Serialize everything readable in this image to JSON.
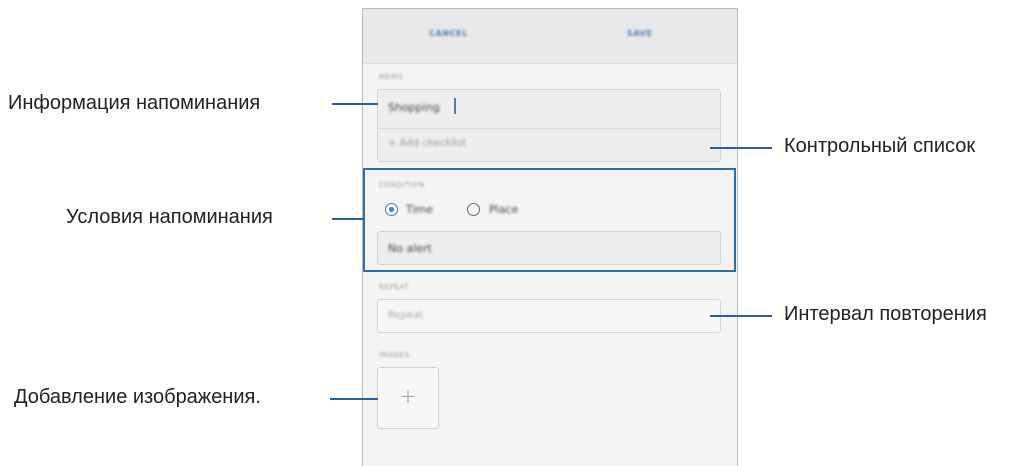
{
  "callouts": {
    "reminder_info": "Информация напоминания",
    "reminder_conditions": "Условия напоминания",
    "add_image": "Добавление изображения.",
    "checklist": "Контрольный список",
    "repeat_interval": "Интервал повторения"
  },
  "phone": {
    "topbar": {
      "cancel": "CANCEL",
      "save": "SAVE"
    },
    "memo": {
      "label": "MEMO",
      "value": "Shopping",
      "add_checklist": "+  Add checklist"
    },
    "condition": {
      "label": "CONDITION",
      "options": [
        {
          "label": "Time",
          "selected": true
        },
        {
          "label": "Place",
          "selected": false
        }
      ],
      "alert": "No alert"
    },
    "repeat": {
      "label": "REPEAT",
      "placeholder": "Repeat"
    },
    "images": {
      "label": "IMAGES",
      "add_symbol": "+"
    }
  },
  "colors": {
    "accent": "#2a6db0",
    "radio_accent": "#4a7fb6"
  }
}
